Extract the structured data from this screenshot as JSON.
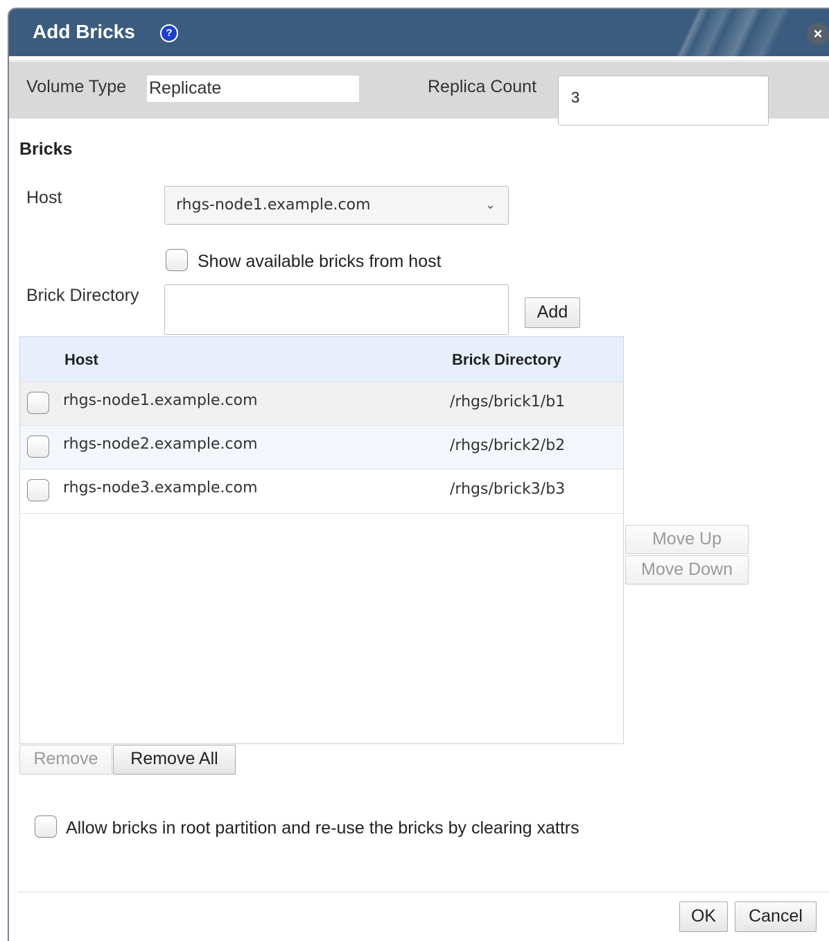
{
  "dialog": {
    "title": "Add Bricks",
    "help_icon": "question-circle-icon",
    "close_icon": "close-circle-icon"
  },
  "volume": {
    "type_label": "Volume Type",
    "type_value": "Replicate",
    "replica_label": "Replica Count",
    "replica_value": "3"
  },
  "bricks": {
    "section_title": "Bricks",
    "host_label": "Host",
    "host_selected": "rhgs-node1.example.com",
    "show_available_label": "Show available bricks from host",
    "brick_dir_label": "Brick Directory",
    "brick_dir_value": "",
    "add_button": "Add"
  },
  "grid": {
    "headers": [
      "Host",
      "Brick Directory"
    ],
    "rows": [
      {
        "host": "rhgs-node1.example.com",
        "dir": "/rhgs/brick1/b1"
      },
      {
        "host": "rhgs-node2.example.com",
        "dir": "/rhgs/brick2/b2"
      },
      {
        "host": "rhgs-node3.example.com",
        "dir": "/rhgs/brick3/b3"
      }
    ]
  },
  "actions": {
    "move_up": "Move Up",
    "move_down": "Move Down",
    "remove": "Remove",
    "remove_all": "Remove All"
  },
  "allow_root_label": "Allow bricks in root partition and re-use the bricks by clearing xattrs",
  "footer": {
    "ok": "OK",
    "cancel": "Cancel"
  },
  "colors": {
    "titlebar": "#3b5c7e",
    "grid_header": "#e8effb",
    "selected_row": "#f0f0f0"
  }
}
